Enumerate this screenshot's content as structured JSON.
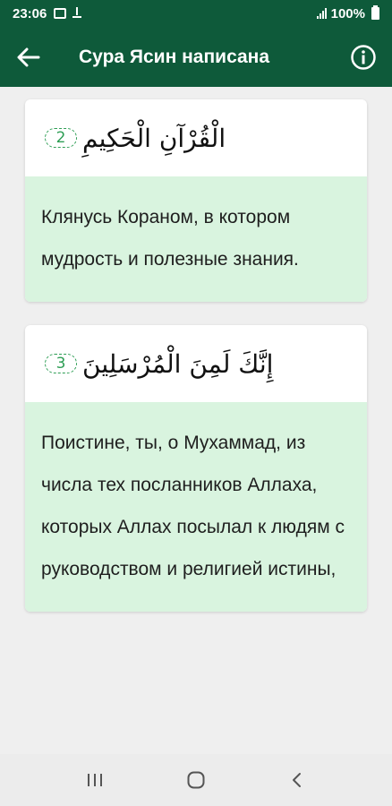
{
  "status_bar": {
    "time": "23:06",
    "battery": "100%",
    "icons": [
      "image-icon",
      "app-notification-icon",
      "signal-icon",
      "battery-icon"
    ]
  },
  "app_bar": {
    "title": "Сура Ясин написана",
    "back_icon": "arrow-left-icon",
    "info_icon": "info-icon",
    "color": "#0e5a3a"
  },
  "verses": [
    {
      "arabic": "الْقُرْآنِ الْحَكِيمِ",
      "number": "2",
      "translation": "Клянусь Кораном, в котором мудрость и полезные знания."
    },
    {
      "arabic": "إِنَّكَ لَمِنَ الْمُرْسَلِينَ",
      "number": "3",
      "translation": "Поистине, ты, о Мухаммад, из числа тех посланников Аллаха, которых Аллах посылал к людям с руководством и религией истины,"
    }
  ],
  "colors": {
    "translation_bg": "#d9f4df",
    "verse_number": "#2e9e55"
  },
  "nav_bar": {
    "icons": [
      "recent-apps-icon",
      "home-icon",
      "back-icon"
    ]
  }
}
